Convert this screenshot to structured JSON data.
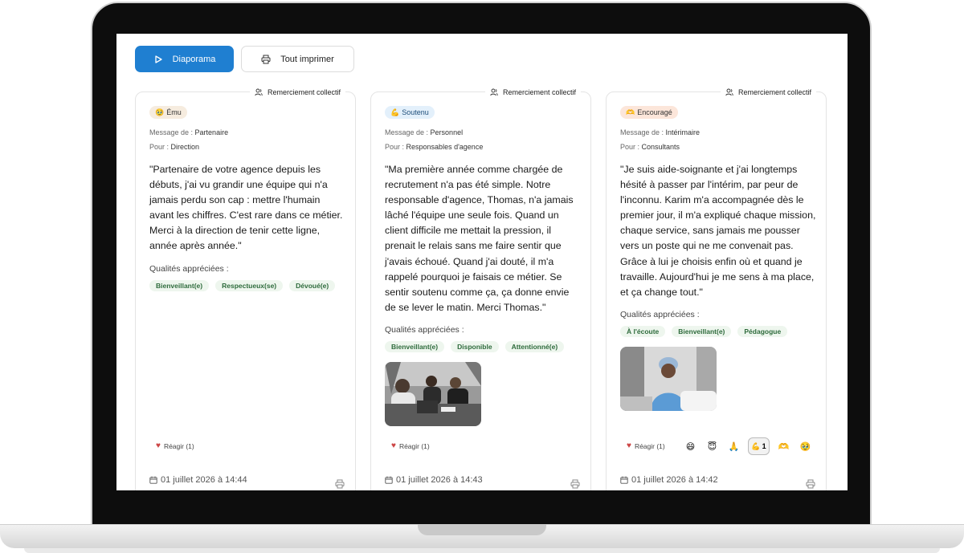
{
  "toolbar": {
    "slideshow_label": "Diaporama",
    "print_all_label": "Tout imprimer"
  },
  "labels": {
    "collective": "Remerciement collectif",
    "from": "Message de :",
    "to": "Pour :",
    "qualities": "Qualités appréciées :",
    "react": "Réagir (1)"
  },
  "cards": [
    {
      "mood": "Ému",
      "mood_emoji": "🥹",
      "from": "Partenaire",
      "to": "Direction",
      "quote": "\"Partenaire de votre agence depuis les débuts, j'ai vu grandir une équipe qui n'a jamais perdu son cap : mettre l'humain avant les chiffres. C'est rare dans ce métier. Merci à la direction de tenir cette ligne, année après année.\"",
      "tags": [
        "Bienveillant(e)",
        "Respectueux(se)",
        "Dévoué(e)"
      ],
      "date": "01 juillet 2026 à 14:44"
    },
    {
      "mood": "Soutenu",
      "mood_emoji": "💪",
      "from": "Personnel",
      "to": "Responsables d'agence",
      "quote": "\"Ma première année comme chargée de recrutement n'a pas été simple. Notre responsable d'agence, Thomas, n'a jamais lâché l'équipe une seule fois. Quand un client difficile me mettait la pression, il prenait le relais sans me faire sentir que j'avais échoué. Quand j'ai douté, il m'a rappelé pourquoi je faisais ce métier. Se sentir soutenu comme ça, ça donne envie de se lever le matin. Merci Thomas.\"",
      "tags": [
        "Bienveillant(e)",
        "Disponible",
        "Attentionné(e)"
      ],
      "date": "01 juillet 2026 à 14:43"
    },
    {
      "mood": "Encouragé",
      "mood_emoji": "🫶",
      "from": "Intérimaire",
      "to": "Consultants",
      "quote": "\"Je suis aide-soignante et j'ai longtemps hésité à passer par l'intérim, par peur de l'inconnu. Karim m'a accompagnée dès le premier jour, il m'a expliqué chaque mission, chaque service, sans jamais me pousser vers un poste qui ne me convenait pas. Grâce à lui je choisis enfin où et quand je travaille. Aujourd'hui je me sens à ma place, et ça change tout.\"",
      "tags": [
        "À l'écoute",
        "Bienveillant(e)",
        "Pédagogue"
      ],
      "date": "01 juillet 2026 à 14:42",
      "reactions": [
        "😄",
        "😇",
        "🙏",
        "💪",
        "🫶",
        "🥹"
      ],
      "active_reaction_count": "1"
    }
  ],
  "colors": {
    "primary": "#1f7fd1",
    "tag_bg": "#eef6ee",
    "tag_text": "#2e6b3c"
  }
}
